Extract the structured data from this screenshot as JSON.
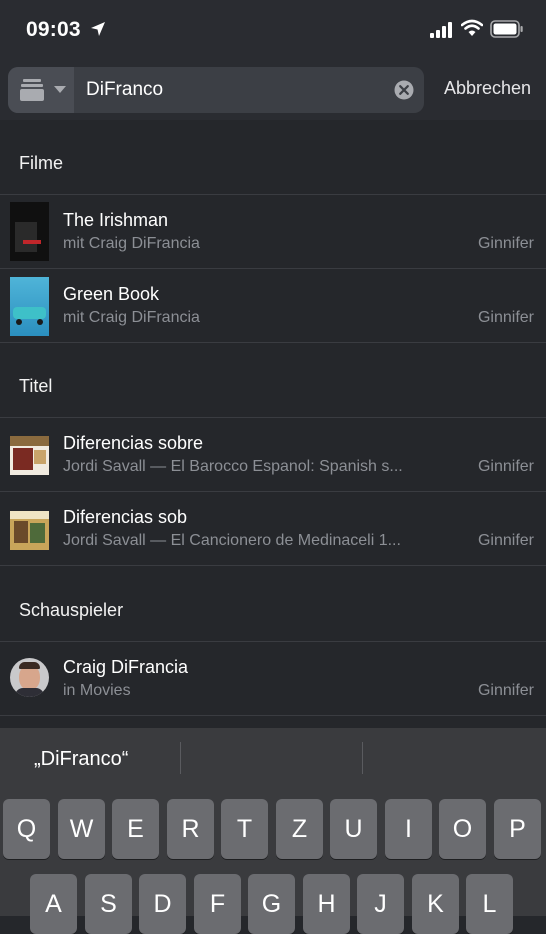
{
  "status": {
    "time": "09:03"
  },
  "search": {
    "query": "DiFranco",
    "cancel_label": "Abbrechen"
  },
  "sections": [
    {
      "title": "Filme",
      "rows": [
        {
          "title": "The Irishman",
          "subtitle": "mit Craig DiFrancia",
          "right": "Ginnifer"
        },
        {
          "title": "Green Book",
          "subtitle": "mit Craig DiFrancia",
          "right": "Ginnifer"
        }
      ]
    },
    {
      "title": "Titel",
      "rows": [
        {
          "title": "Diferencias sobre",
          "subtitle": "Jordi Savall — El Barocco Espanol: Spanish s...",
          "right": "Ginnifer"
        },
        {
          "title": "Diferencias sob",
          "subtitle": "Jordi Savall — El Cancionero de Medinaceli 1...",
          "right": "Ginnifer"
        }
      ]
    },
    {
      "title": "Schauspieler",
      "rows": [
        {
          "title": "Craig DiFrancia",
          "subtitle": "in Movies",
          "right": "Ginnifer"
        }
      ]
    }
  ],
  "keyboard": {
    "suggestion": "„DiFranco“",
    "row1": [
      "Q",
      "W",
      "E",
      "R",
      "T",
      "Z",
      "U",
      "I",
      "O",
      "P"
    ],
    "row2": [
      "A",
      "S",
      "D",
      "F",
      "G",
      "H",
      "J",
      "K",
      "L"
    ]
  },
  "icons": {
    "location": "location-arrow-icon",
    "signal": "cellular-signal-icon",
    "wifi": "wifi-icon",
    "battery": "battery-icon",
    "scope": "library-stack-icon",
    "scope_chevron": "chevron-down-icon",
    "clear": "clear-icon"
  },
  "colors": {
    "background": "#25272b",
    "bar": "#2a2c31",
    "secondary_text": "#8c8f95",
    "keyboard": "#3a3b3e",
    "key": "#6b6c70"
  }
}
